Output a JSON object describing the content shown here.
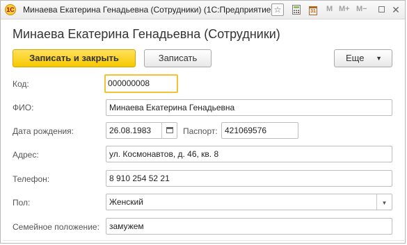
{
  "window": {
    "title": "Минаева Екатерина Генадьевна (Сотрудники)  (1С:Предприятие)",
    "app_icon_text": "1С",
    "toolbar_icons": [
      "star-icon",
      "calculator-icon",
      "calendar-icon",
      "m-icon",
      "m-plus-icon",
      "m-minus-icon",
      "restore-icon",
      "close-icon"
    ],
    "m_label": "M",
    "m_plus_label": "M+",
    "m_minus_label": "M−",
    "calendar_day": "31"
  },
  "form": {
    "title": "Минаева Екатерина Генадьевна (Сотрудники)",
    "buttons": {
      "save_close": "Записать и закрыть",
      "save": "Записать",
      "more": "Еще"
    },
    "fields": {
      "code": {
        "label": "Код:",
        "value": "000000008"
      },
      "fio": {
        "label": "ФИО:",
        "value": "Минаева Екатерина Генадьевна"
      },
      "birth_date": {
        "label": "Дата рождения:",
        "value": "26.08.1983"
      },
      "passport": {
        "label": "Паспорт:",
        "value": "421069576"
      },
      "address": {
        "label": "Адрес:",
        "value": "ул. Космонавтов, д. 46, кв. 8"
      },
      "phone": {
        "label": "Телефон:",
        "value": "8 910 254 52 21"
      },
      "gender": {
        "label": "Пол:",
        "value": "Женский"
      },
      "marital_status": {
        "label": "Семейное положение:",
        "value": "замужем"
      }
    }
  },
  "colors": {
    "primary_button": "#f6c800",
    "focus_border": "#f1c232",
    "title_text": "#333333"
  }
}
